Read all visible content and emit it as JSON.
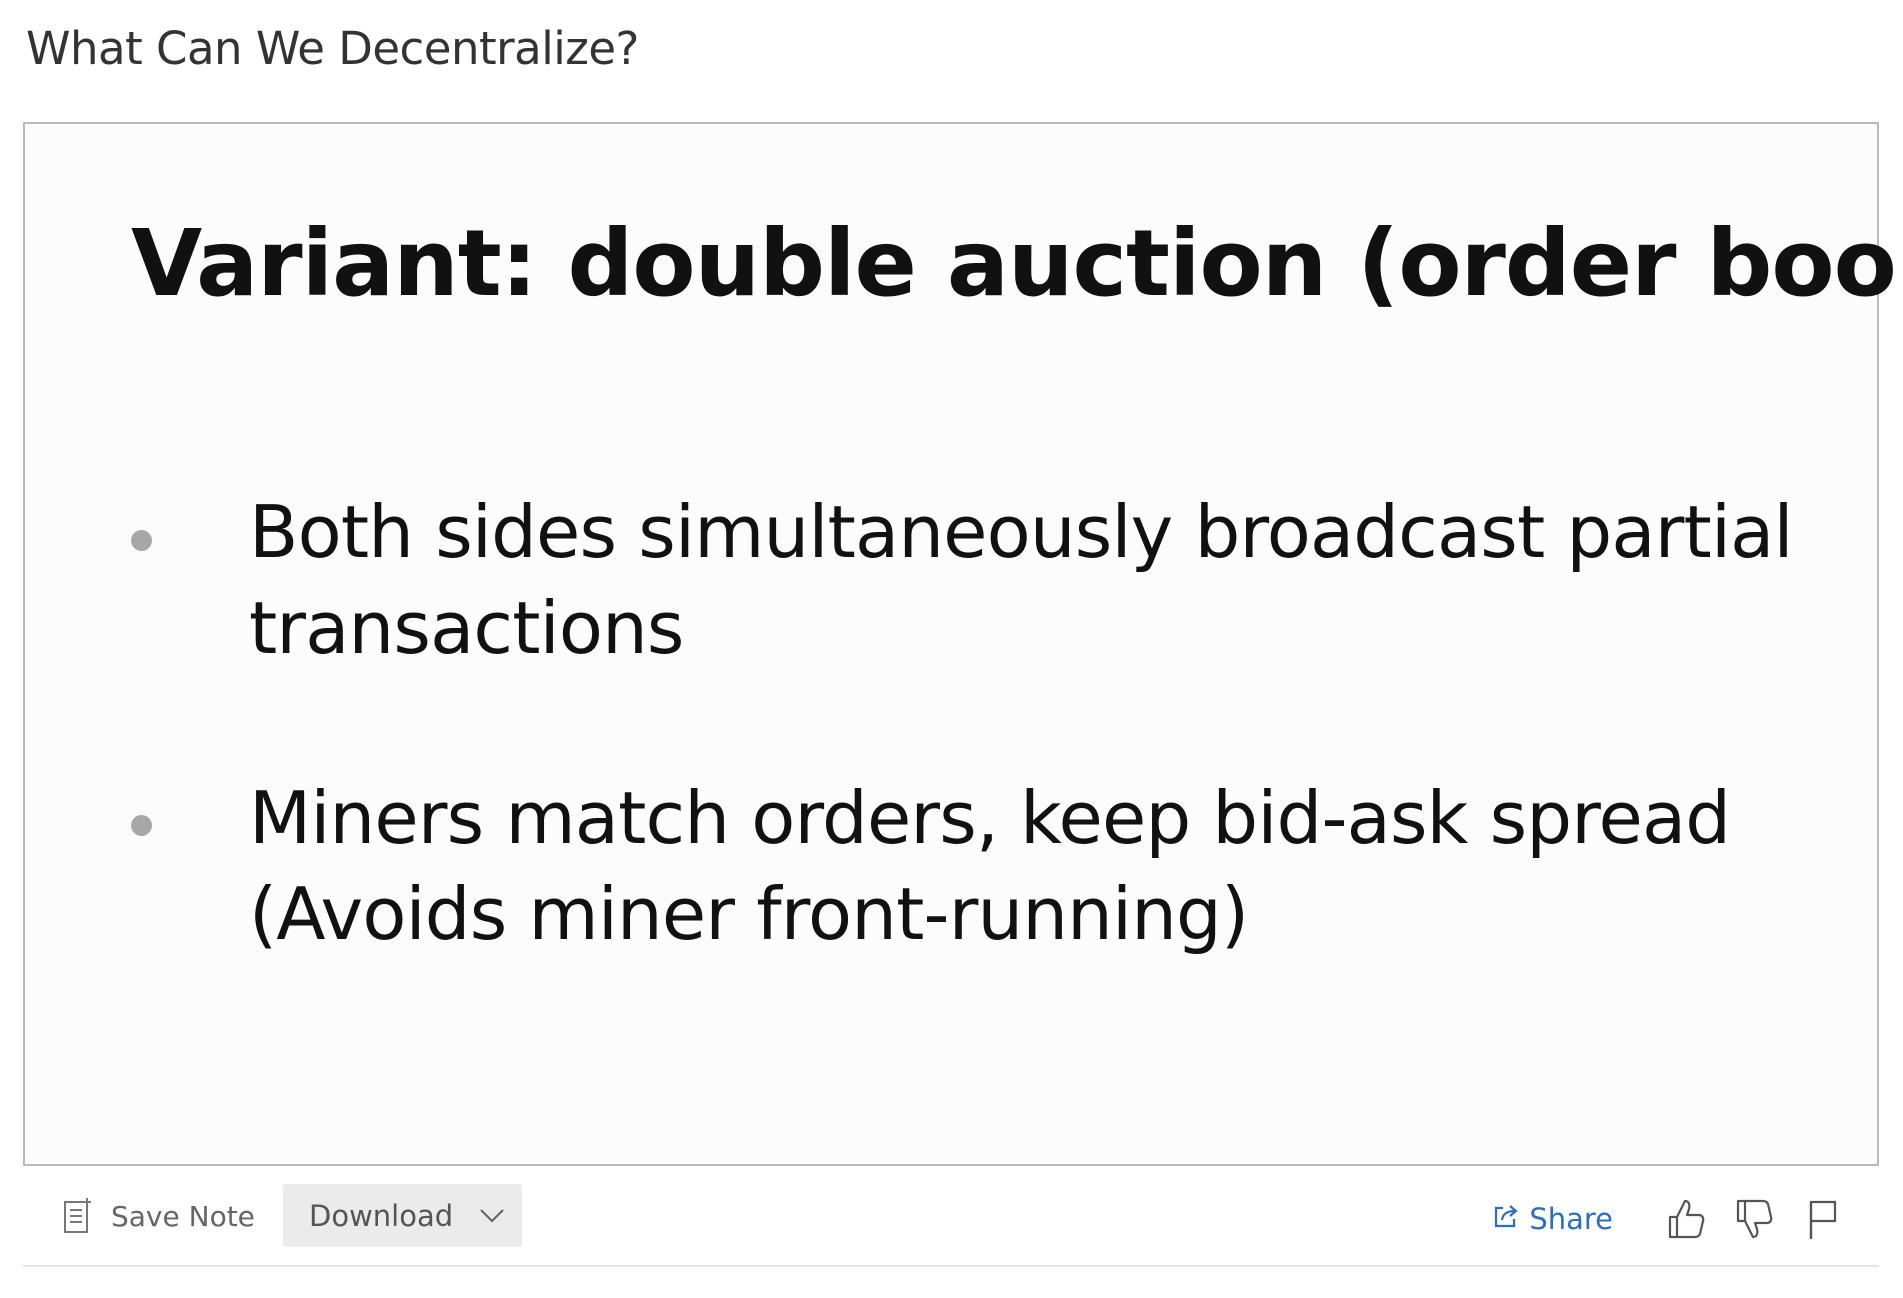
{
  "header": {
    "title": "What Can We Decentralize?"
  },
  "slide": {
    "heading": "Variant: double auction (order book)",
    "bullets": [
      "Both sides simultaneously broadcast partial transactions",
      "Miners match orders, keep bid-ask spread (Avoids miner front-running)"
    ]
  },
  "toolbar": {
    "save_note_label": "Save Note",
    "download_label": "Download",
    "share_label": "Share",
    "icons": {
      "save_note": "note-icon",
      "download_dropdown": "chevron-down-icon",
      "share": "share-icon",
      "like": "thumbs-up-icon",
      "dislike": "thumbs-down-icon",
      "flag": "flag-icon"
    }
  },
  "colors": {
    "share_link": "#2e6fb8",
    "slide_border": "#b9b9b9",
    "download_bg": "#ebebeb"
  }
}
